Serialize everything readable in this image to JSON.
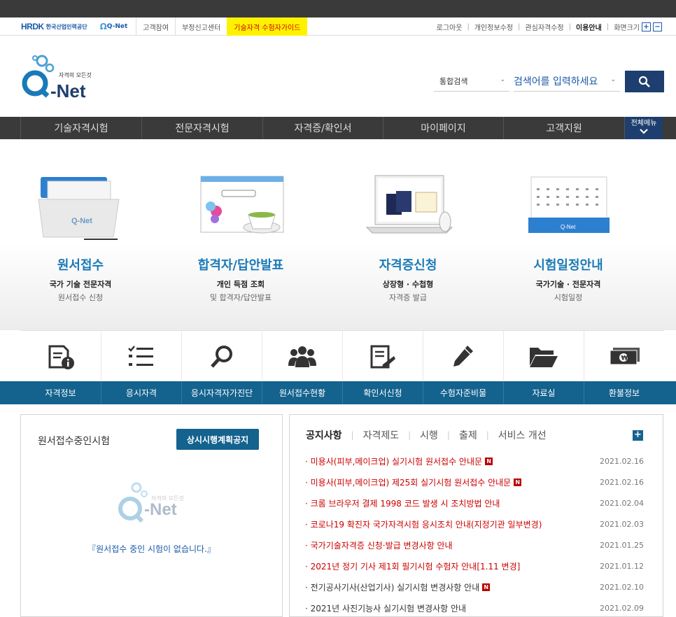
{
  "util": {
    "hrdk": "HRDK",
    "hrdk_sub": "한국산업인력공단",
    "qnet_mini": "Q-Net",
    "links": [
      "고객참여",
      "부정신고센터"
    ],
    "highlight": "기술자격 수험자가이드",
    "right": [
      "로그아웃",
      "개인정보수정",
      "관심자격수정",
      "이용안내",
      "화면크기"
    ],
    "zoom_plus": "+",
    "zoom_minus": "−"
  },
  "logo": {
    "tag": "자격의 모든것",
    "name": "-Net"
  },
  "search": {
    "scope": "통합검색",
    "placeholder": "검색어를 입력하세요"
  },
  "gnb": {
    "items": [
      "기술자격시험",
      "전문자격시험",
      "자격증/확인서",
      "마이페이지",
      "고객지원"
    ],
    "all_menu": "전체메뉴"
  },
  "hero": [
    {
      "title": "원서접수",
      "sub1": "국가 기술 전문자격",
      "sub2": "원서접수 신청"
    },
    {
      "title": "합격자/답안발표",
      "sub1": "개인 득점 조회",
      "sub2": "및 합격자/답안발표"
    },
    {
      "title": "자격증신청",
      "sub1": "상장형 · 수첩형",
      "sub2": "자격증 발급"
    },
    {
      "title": "시험일정안내",
      "sub1": "국가기술 · 전문자격",
      "sub2": "시험일정"
    }
  ],
  "quick": [
    "자격정보",
    "응시자격",
    "응시자격자가진단",
    "원서접수현황",
    "확인서신청",
    "수험자준비물",
    "자료실",
    "환불정보"
  ],
  "left_box": {
    "title": "원서접수중인시험",
    "button": "상시시행계획공지",
    "wm_tag": "자격의 모든것",
    "wm_name": "-Net",
    "empty": "『원서접수 중인 시험이 없습니다.』"
  },
  "notice_tabs": [
    "공지사항",
    "자격제도",
    "시행",
    "출제",
    "서비스 개선"
  ],
  "notices": [
    {
      "text": "· 미용사(피부,메이크업) 실기시험 원서접수 안내문",
      "new": "N",
      "date": "2021.02.16",
      "red": true
    },
    {
      "text": "· 미용사(피부,메이크업) 제25회 실기시험 원서접수 안내문",
      "new": "N",
      "date": "2021.02.16",
      "red": true
    },
    {
      "text": "· 크롬 브라우저 결제 1998 코드 발생 시 조치방법 안내",
      "new": "",
      "date": "2021.02.04",
      "red": true
    },
    {
      "text": "· 코로나19 확진자 국가자격시험 응시조치 안내(지정기관 일부변경)",
      "new": "",
      "date": "2021.02.03",
      "red": true
    },
    {
      "text": "· 국가기술자격증 신청·발급 변경사항 안내",
      "new": "",
      "date": "2021.01.25",
      "red": true
    },
    {
      "text": "· 2021년 정기 기사 제1회 필기시험 수험자 안내[1.11 변경]",
      "new": "",
      "date": "2021.01.12",
      "red": true
    },
    {
      "text": "· 전기공사기사(산업기사) 실기시험 변경사항 안내",
      "new": "N",
      "date": "2021.02.10",
      "red": false
    },
    {
      "text": "· 2021년 사진기능사 실기시험 변경사항 안내",
      "new": "",
      "date": "2021.02.09",
      "red": false
    }
  ]
}
